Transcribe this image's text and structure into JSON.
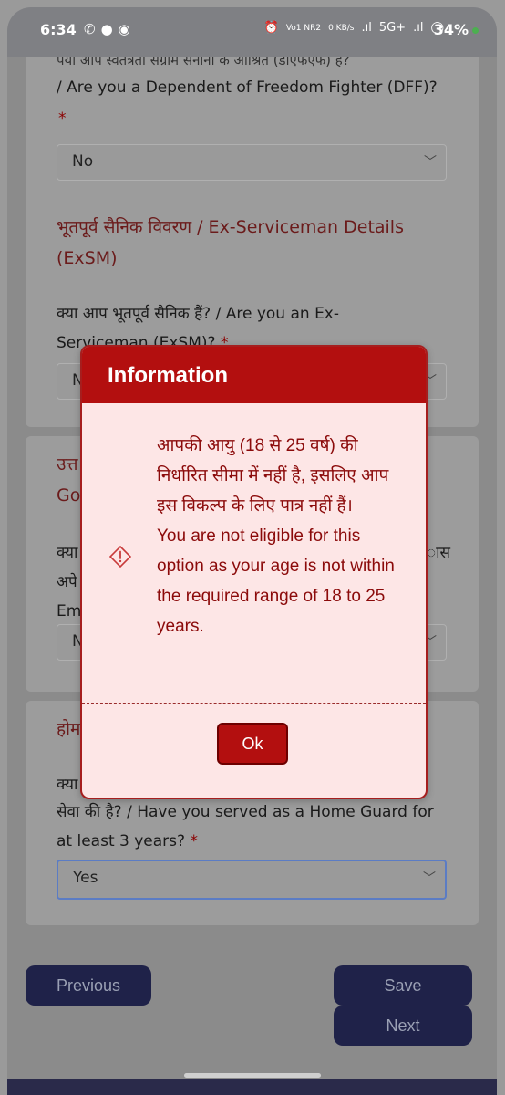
{
  "status_bar": {
    "time": "6:34",
    "left_icons": [
      "whatsapp-icon",
      "chat-icon",
      "app-icon"
    ],
    "right_text": [
      "⏰",
      "Vo1 NR2",
      "0 KB/s",
      ".ıl",
      "5G+",
      ".ıl",
      "◯"
    ],
    "battery": "34%"
  },
  "form": {
    "dff": {
      "question_top": "पया आप स्वतंत्रता संग्राम सेनानी के आश्रित (डीएफएफ) हैं?",
      "question": "/ Are you a Dependent of Freedom Fighter (DFF)?",
      "required": "*",
      "selected": "No"
    },
    "exsm": {
      "title_line1": "भूतपूर्व सैनिक विवरण / Ex-Serviceman Details",
      "title_line2": "(ExSM)",
      "question_line1": "क्या आप भूतपूर्व सैनिक हैं? / Are you an Ex-",
      "question_line2": "Serviceman (ExSM)?",
      "required": "*",
      "selected": "N"
    },
    "gov": {
      "title_line1": "उत्त",
      "title_line2": "Go",
      "question_line1": "क्या",
      "question_line1_right": "ास",
      "question_line2": "अपे",
      "question_line3": "Em",
      "selected": "N"
    },
    "home_guard": {
      "title": "होम",
      "question_line1": "क्या",
      "question_line2": "सेवा की है? / Have you served as a Home Guard for",
      "question_line3": "at least 3 years?",
      "required": "*",
      "selected": "Yes"
    }
  },
  "buttons": {
    "previous": "Previous",
    "save": "Save",
    "next": "Next"
  },
  "modal": {
    "title": "Information",
    "message_hindi": "आपकी आयु (18 से 25 वर्ष) की निर्धारित सीमा में नहीं है, इसलिए आप इस विकल्प के लिए पात्र नहीं हैं।",
    "message_english": "You are not eligible for this option as your age is not within the required range of 18 to 25 years.",
    "ok": "Ok",
    "icon": "warning-diamond-icon"
  }
}
